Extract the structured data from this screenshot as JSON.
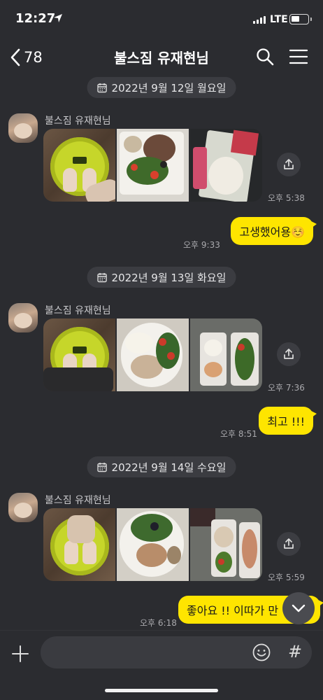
{
  "status_bar": {
    "time": "12:27",
    "network": "LTE",
    "battery_level": 0.5
  },
  "header": {
    "back_count": "78",
    "title": "불스짐 유재현님"
  },
  "messages": [
    {
      "date": "2022년 9월 12일 월요일",
      "sender": "불스짐 유재현님",
      "photo_time": "오후 5:38",
      "reply": "고생했어용☺️",
      "reply_time": "오후 9:33"
    },
    {
      "date": "2022년 9월 13일 화요일",
      "sender": "불스짐 유재현님",
      "photo_time": "오후 7:36",
      "reply": "최고 !!!",
      "reply_time": "오후 8:51"
    },
    {
      "date": "2022년 9월 14일 수요일",
      "sender": "불스짐 유재현님",
      "photo_time": "오후 5:59",
      "reply": "좋아요 !! 이따가 만",
      "reply_time": "오후 6:18"
    }
  ],
  "input": {
    "placeholder": ""
  },
  "colors": {
    "bubble_out": "#fee500",
    "background": "#2b2c30",
    "date_pill": "#3b3c41"
  },
  "icons": [
    "location-arrow-icon",
    "signal-icon",
    "battery-icon",
    "back-chevron-icon",
    "search-icon",
    "menu-icon",
    "calendar-icon",
    "share-icon",
    "chevron-down-icon",
    "plus-icon",
    "emoji-icon",
    "hash-icon"
  ]
}
